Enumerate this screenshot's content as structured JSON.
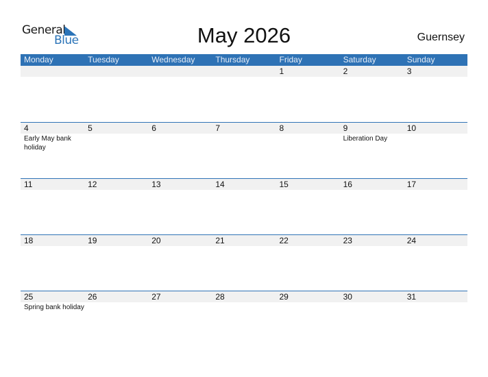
{
  "logo": {
    "word1": "General",
    "word2": "Blue"
  },
  "title": "May 2026",
  "country": "Guernsey",
  "colors": {
    "accent": "#2e72b5",
    "band": "#f1f1f1"
  },
  "weekdays": [
    "Monday",
    "Tuesday",
    "Wednesday",
    "Thursday",
    "Friday",
    "Saturday",
    "Sunday"
  ],
  "weeks": [
    {
      "days": [
        "",
        "",
        "",
        "",
        "1",
        "2",
        "3"
      ],
      "events": [
        "",
        "",
        "",
        "",
        "",
        "",
        ""
      ]
    },
    {
      "days": [
        "4",
        "5",
        "6",
        "7",
        "8",
        "9",
        "10"
      ],
      "events": [
        "Early May bank holiday",
        "",
        "",
        "",
        "",
        "Liberation Day",
        ""
      ]
    },
    {
      "days": [
        "11",
        "12",
        "13",
        "14",
        "15",
        "16",
        "17"
      ],
      "events": [
        "",
        "",
        "",
        "",
        "",
        "",
        ""
      ]
    },
    {
      "days": [
        "18",
        "19",
        "20",
        "21",
        "22",
        "23",
        "24"
      ],
      "events": [
        "",
        "",
        "",
        "",
        "",
        "",
        ""
      ]
    },
    {
      "days": [
        "25",
        "26",
        "27",
        "28",
        "29",
        "30",
        "31"
      ],
      "events": [
        "Spring bank holiday",
        "",
        "",
        "",
        "",
        "",
        ""
      ]
    }
  ]
}
